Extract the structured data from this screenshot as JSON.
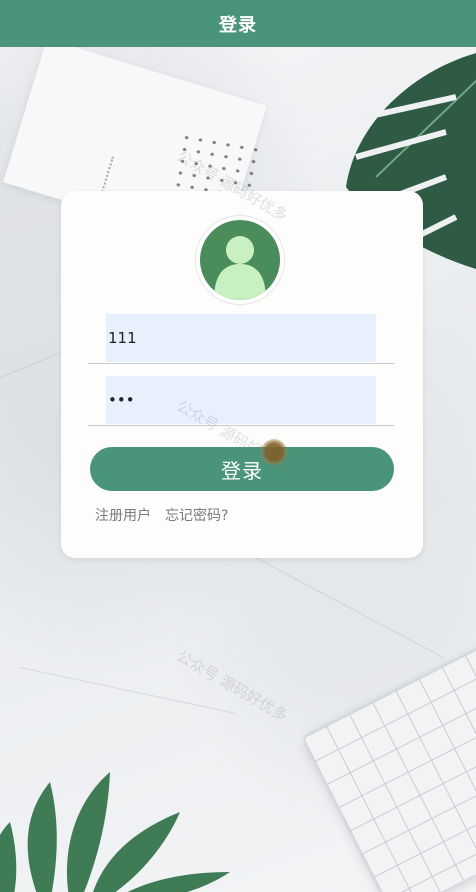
{
  "header": {
    "title": "登录"
  },
  "login_form": {
    "username_value": "111",
    "password_value": "111",
    "submit_label": "登录",
    "register_link": "注册用户",
    "forgot_link": "忘记密码?"
  },
  "watermark": {
    "text": "公众号 源码好优多"
  },
  "colors": {
    "primary": "#4a9479",
    "avatar_bg": "#4a8c5c",
    "input_bg": "#e8f0fe"
  }
}
